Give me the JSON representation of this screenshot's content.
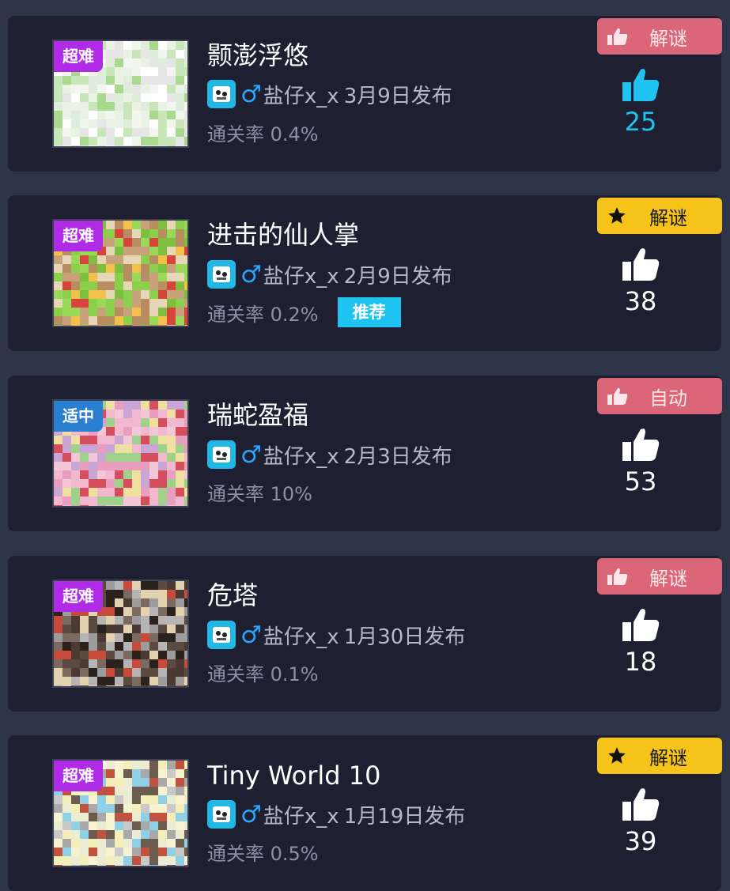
{
  "items": [
    {
      "title": "颢澎浮悠",
      "difficulty": "超难",
      "difficulty_color": "#b02be6",
      "author": "盐仔x_x",
      "date": "3月9日发布",
      "gender_symbol": "♂",
      "pass_rate": "通关率 0.4%",
      "tag": "解谜",
      "tag_style": "pink",
      "tag_icon": "thumbs-up-icon",
      "likes": "25",
      "liked": true,
      "thumb_theme": "white-green"
    },
    {
      "title": "进击的仙人掌",
      "difficulty": "超难",
      "difficulty_color": "#b02be6",
      "author": "盐仔x_x",
      "date": "2月9日发布",
      "gender_symbol": "♂",
      "pass_rate": "通关率 0.2%",
      "recommend": "推荐",
      "tag": "解谜",
      "tag_style": "yellow",
      "tag_icon": "star-icon",
      "likes": "38",
      "liked": false,
      "thumb_theme": "green-brown"
    },
    {
      "title": "瑞蛇盈福",
      "difficulty": "适中",
      "difficulty_color": "#2a7fd1",
      "author": "盐仔x_x",
      "date": "2月3日发布",
      "gender_symbol": "♂",
      "pass_rate": "通关率 10%",
      "tag": "自动",
      "tag_style": "pink",
      "tag_icon": "thumbs-up-icon",
      "likes": "53",
      "liked": false,
      "thumb_theme": "pink"
    },
    {
      "title": "危塔",
      "difficulty": "超难",
      "difficulty_color": "#b02be6",
      "author": "盐仔x_x",
      "date": "1月30日发布",
      "gender_symbol": "♂",
      "pass_rate": "通关率 0.1%",
      "tag": "解谜",
      "tag_style": "pink",
      "tag_icon": "thumbs-up-icon",
      "likes": "18",
      "liked": false,
      "thumb_theme": "dark-gray"
    },
    {
      "title": "Tiny World 10",
      "difficulty": "超难",
      "difficulty_color": "#b02be6",
      "author": "盐仔x_x",
      "date": "1月19日发布",
      "gender_symbol": "♂",
      "pass_rate": "通关率 0.5%",
      "tag": "解谜",
      "tag_style": "yellow",
      "tag_icon": "star-icon",
      "likes": "39",
      "liked": false,
      "thumb_theme": "cream-gray"
    }
  ],
  "colors": {
    "background": "#2e3548",
    "card": "#1e1f31",
    "accent": "#1ec3f2",
    "tag_pink": "#db6677",
    "tag_yellow": "#f6c31a",
    "gender_blue": "#2aa6ff"
  }
}
